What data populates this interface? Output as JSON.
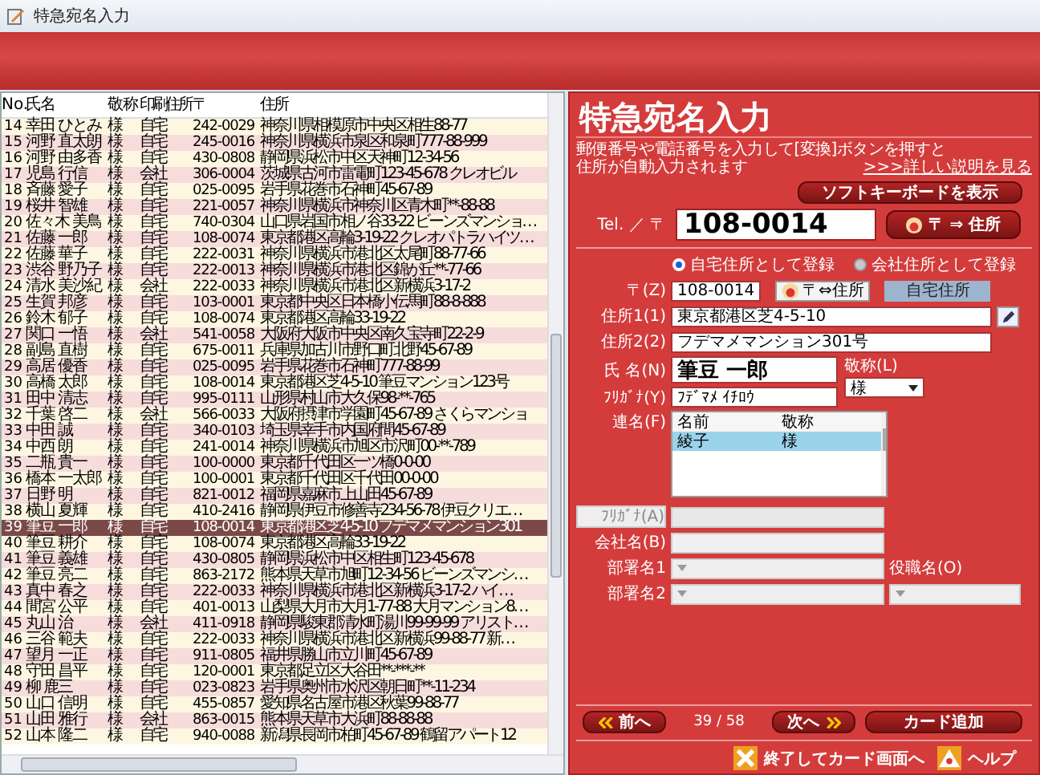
{
  "window": {
    "title": "特急宛名入力"
  },
  "table": {
    "columns": [
      "No.",
      "氏名",
      "敬称",
      "印刷住所",
      "〒",
      "住所"
    ],
    "rows": [
      {
        "no": "14",
        "name": "幸田 ひとみ",
        "honorific": "様",
        "print_address": "自宅",
        "zip": "242-0029",
        "address": "神奈川県相模原市中央区相生88-77",
        "selected": false
      },
      {
        "no": "15",
        "name": "河野 直太朗",
        "honorific": "様",
        "print_address": "自宅",
        "zip": "245-0016",
        "address": "神奈川県横浜市泉区和泉町777-88-999",
        "selected": false
      },
      {
        "no": "16",
        "name": "河野 由多香",
        "honorific": "様",
        "print_address": "自宅",
        "zip": "430-0808",
        "address": "静岡県浜松市中区天神町12-34-56",
        "selected": false
      },
      {
        "no": "17",
        "name": "児島 行信",
        "honorific": "様",
        "print_address": "会社",
        "zip": "306-0004",
        "address": "茨城県古河市雷電町123-45-678 クレオビル",
        "selected": false
      },
      {
        "no": "18",
        "name": "斉藤 愛子",
        "honorific": "様",
        "print_address": "自宅",
        "zip": "025-0095",
        "address": "岩手県花巻市石神町45-67-89",
        "selected": false
      },
      {
        "no": "19",
        "name": "桜井 智雄",
        "honorific": "様",
        "print_address": "自宅",
        "zip": "221-0057",
        "address": "神奈川県横浜市神奈川区青木町**-88-88",
        "selected": false
      },
      {
        "no": "20",
        "name": "佐々木 美鳥",
        "honorific": "様",
        "print_address": "自宅",
        "zip": "740-0304",
        "address": "山口県岩国市相ノ谷33-22 ビーンズマンショ…",
        "selected": false
      },
      {
        "no": "21",
        "name": "佐藤 一郎",
        "honorific": "様",
        "print_address": "自宅",
        "zip": "108-0074",
        "address": "東京都港区高輪3-19-22 クレオパトラハイツ…",
        "selected": false
      },
      {
        "no": "22",
        "name": "佐藤 華子",
        "honorific": "様",
        "print_address": "自宅",
        "zip": "222-0031",
        "address": "神奈川県横浜市港北区太尾町88-77-66",
        "selected": false
      },
      {
        "no": "23",
        "name": "渋谷 野乃子",
        "honorific": "様",
        "print_address": "自宅",
        "zip": "222-0013",
        "address": "神奈川県横浜市港北区錦が丘**-77-66",
        "selected": false
      },
      {
        "no": "24",
        "name": "清水 美沙紀",
        "honorific": "様",
        "print_address": "会社",
        "zip": "222-0033",
        "address": "神奈川県横浜市港北区新横浜3-17-2",
        "selected": false
      },
      {
        "no": "25",
        "name": "生賀 邦彦",
        "honorific": "様",
        "print_address": "自宅",
        "zip": "103-0001",
        "address": "東京都中央区日本橋小伝馬町88-8-888",
        "selected": false
      },
      {
        "no": "26",
        "name": "鈴木 郁子",
        "honorific": "様",
        "print_address": "自宅",
        "zip": "108-0074",
        "address": "東京都港区高輪33-19-22",
        "selected": false
      },
      {
        "no": "27",
        "name": "関口 一悟",
        "honorific": "様",
        "print_address": "会社",
        "zip": "541-0058",
        "address": "大阪府大阪市中央区南久宝寺町22-2-9",
        "selected": false
      },
      {
        "no": "28",
        "name": "副島 直樹",
        "honorific": "様",
        "print_address": "自宅",
        "zip": "675-0011",
        "address": "兵庫県加古川市野口町北野45-67-89",
        "selected": false
      },
      {
        "no": "29",
        "name": "高居 優香",
        "honorific": "様",
        "print_address": "自宅",
        "zip": "025-0095",
        "address": "岩手県花巻市石神町777-88-99",
        "selected": false
      },
      {
        "no": "30",
        "name": "高橋 太郎",
        "honorific": "様",
        "print_address": "自宅",
        "zip": "108-0014",
        "address": "東京都港区芝4-5-10 筆豆マンション123号",
        "selected": false
      },
      {
        "no": "31",
        "name": "田中 清志",
        "honorific": "様",
        "print_address": "自宅",
        "zip": "995-0111",
        "address": "山形県村山市大久保98-**-765",
        "selected": false
      },
      {
        "no": "32",
        "name": "千葉 啓二",
        "honorific": "様",
        "print_address": "会社",
        "zip": "566-0033",
        "address": "大阪府摂津市学園町45-67-89 さくらマンショ",
        "selected": false
      },
      {
        "no": "33",
        "name": "中田 誠",
        "honorific": "様",
        "print_address": "自宅",
        "zip": "340-0103",
        "address": "埼玉県幸手市内国府間45-67-89",
        "selected": false
      },
      {
        "no": "34",
        "name": "中西 朗",
        "honorific": "様",
        "print_address": "自宅",
        "zip": "241-0014",
        "address": "神奈川県横浜市旭区市沢町00-**-789",
        "selected": false
      },
      {
        "no": "35",
        "name": "二瓶 貴一",
        "honorific": "様",
        "print_address": "自宅",
        "zip": "100-0000",
        "address": "東京都千代田区一ツ橋0-0-00",
        "selected": false
      },
      {
        "no": "36",
        "name": "橋本 一太郎",
        "honorific": "様",
        "print_address": "自宅",
        "zip": "100-0001",
        "address": "東京都千代田区千代田00-0-00",
        "selected": false
      },
      {
        "no": "37",
        "name": "日野 明",
        "honorific": "様",
        "print_address": "自宅",
        "zip": "821-0012",
        "address": "福岡県嘉麻市上山田45-67-89",
        "selected": false
      },
      {
        "no": "38",
        "name": "横山 夏輝",
        "honorific": "様",
        "print_address": "自宅",
        "zip": "410-2416",
        "address": "静岡県伊豆市修善寺234-56-78 伊豆クリエ…",
        "selected": false
      },
      {
        "no": "39",
        "name": "筆豆 一郎",
        "honorific": "様",
        "print_address": "自宅",
        "zip": "108-0014",
        "address": "東京都港区芝4-5-10 フデマメマンション301",
        "selected": true
      },
      {
        "no": "40",
        "name": "筆豆 耕介",
        "honorific": "様",
        "print_address": "自宅",
        "zip": "108-0074",
        "address": "東京都港区高輪33-19-22",
        "selected": false
      },
      {
        "no": "41",
        "name": "筆豆 義雄",
        "honorific": "様",
        "print_address": "自宅",
        "zip": "430-0805",
        "address": "静岡県浜松市中区相生町123-45-678",
        "selected": false
      },
      {
        "no": "42",
        "name": "筆豆 亮二",
        "honorific": "様",
        "print_address": "自宅",
        "zip": "863-2172",
        "address": "熊本県天草市旭町12-34-56 ビーンズマンシ…",
        "selected": false
      },
      {
        "no": "43",
        "name": "真中 春之",
        "honorific": "様",
        "print_address": "自宅",
        "zip": "222-0033",
        "address": "神奈川県横浜市港北区新横浜3-17-2 ハイ…",
        "selected": false
      },
      {
        "no": "44",
        "name": "間宮 公平",
        "honorific": "様",
        "print_address": "自宅",
        "zip": "401-0013",
        "address": "山梨県大月市大月1-77-88 大月マンション8…",
        "selected": false
      },
      {
        "no": "45",
        "name": "丸山 治",
        "honorific": "様",
        "print_address": "会社",
        "zip": "411-0918",
        "address": "静岡県駿東郡清水町湯川99-99-99 アリスト…",
        "selected": false
      },
      {
        "no": "46",
        "name": "三谷 範夫",
        "honorific": "様",
        "print_address": "自宅",
        "zip": "222-0033",
        "address": "神奈川県横浜市港北区新横浜99-88-77 新…",
        "selected": false
      },
      {
        "no": "47",
        "name": "望月 一正",
        "honorific": "様",
        "print_address": "自宅",
        "zip": "911-0805",
        "address": "福井県勝山市立川町45-67-89",
        "selected": false
      },
      {
        "no": "48",
        "name": "守田 昌平",
        "honorific": "様",
        "print_address": "自宅",
        "zip": "120-0001",
        "address": "東京都足立区大谷田**-***-**",
        "selected": false
      },
      {
        "no": "49",
        "name": "柳 鹿三",
        "honorific": "様",
        "print_address": "自宅",
        "zip": "023-0823",
        "address": "岩手県奥州市水沢区朝日町**-11-234",
        "selected": false
      },
      {
        "no": "50",
        "name": "山口 信明",
        "honorific": "様",
        "print_address": "自宅",
        "zip": "455-0857",
        "address": "愛知県名古屋市港区秋葉99-88-77",
        "selected": false
      },
      {
        "no": "51",
        "name": "山田 雅行",
        "honorific": "様",
        "print_address": "会社",
        "zip": "863-0015",
        "address": "熊本県天草市大浜町88-88-88",
        "selected": false
      },
      {
        "no": "52",
        "name": "山本 隆二",
        "honorific": "様",
        "print_address": "自宅",
        "zip": "940-0088",
        "address": "新潟県長岡市柏町45-67-89 鶴留アパート12",
        "selected": false
      }
    ]
  },
  "form": {
    "title": "特急宛名入力",
    "description": [
      "郵便番号や電話番号を入力して[変換]ボタンを押すと",
      "住所が自動入力されます"
    ],
    "details_link": ">>>詳しい説明を見る",
    "soft_keyboard_button": "ソフトキーボードを表示",
    "lookup": {
      "label": "Tel. ／ 〒",
      "value": "108-0014",
      "button": "〒 ⇒ 住所"
    },
    "register_options": [
      {
        "label": "自宅住所として登録",
        "selected": true
      },
      {
        "label": "会社住所として登録",
        "selected": false
      }
    ],
    "zip": {
      "label": "〒(Z)",
      "value": "108-0014",
      "button": "〒⇔住所",
      "badge": "自宅住所"
    },
    "address1": {
      "label": "住所1(1)",
      "value": "東京都港区芝4-5-10"
    },
    "address2": {
      "label": "住所2(2)",
      "value": "フデマメマンション301号"
    },
    "name": {
      "label": "氏 名(N)",
      "value": "筆豆 一郎"
    },
    "honorific": {
      "label": "敬称(L)",
      "value": "様"
    },
    "furigana": {
      "label": "ﾌﾘｶﾞﾅ(Y)",
      "value": "ﾌﾃﾞﾏﾒ ｲﾁﾛｳ"
    },
    "joint_names": {
      "label": "連名(F)",
      "columns": [
        "名前",
        "敬称"
      ],
      "rows": [
        {
          "name": "綾子",
          "honorific": "様",
          "selected": true
        }
      ]
    },
    "company_furigana": {
      "label": "ﾌﾘｶﾞﾅ(A)",
      "disabled": true
    },
    "company": {
      "label": "会社名(B)",
      "disabled": false
    },
    "department1": {
      "label": "部署名1"
    },
    "department2": {
      "label": "部署名2"
    },
    "position": {
      "label": "役職名(O)"
    },
    "nav": {
      "prev": "前へ",
      "position": "39 / 58",
      "next": "次へ",
      "add": "カード追加"
    },
    "footer": {
      "exit": "終了してカード画面へ",
      "help": "ヘルプ"
    }
  }
}
